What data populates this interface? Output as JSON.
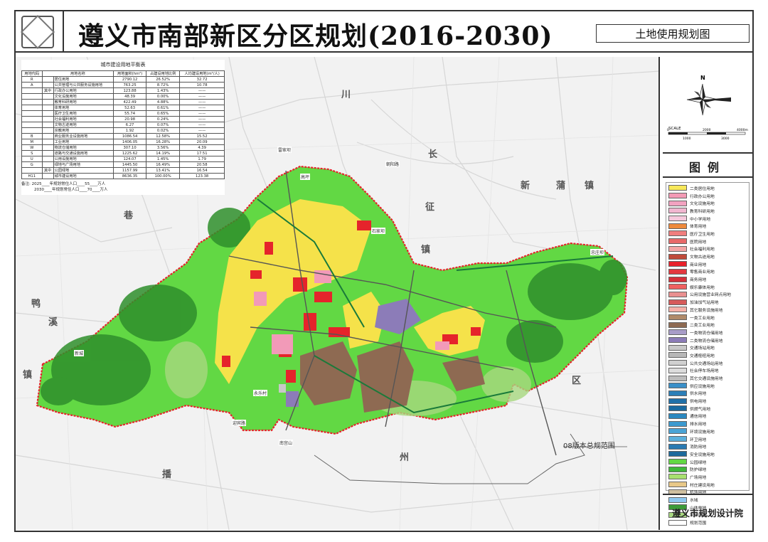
{
  "header": {
    "title": "遵义市南部新区分区规划(2016-2030)",
    "subtitle": "土地使用规划图"
  },
  "map": {
    "place_labels": [
      "川",
      "长",
      "征",
      "镇",
      "新",
      "蒲",
      "镇",
      "巷",
      "鸭",
      "溪",
      "镇",
      "区",
      "州",
      "播"
    ],
    "small_labels": [
      "雷家坝",
      "高坪",
      "石家坝",
      "忠庄坝",
      "新城",
      "永乐村",
      "迎宾路",
      "南宫山",
      "朝阳路"
    ],
    "scope_label": "08版本总规范围"
  },
  "table": {
    "title": "城市建设用地平衡表",
    "headers": [
      "用地代码",
      "用地名称",
      "用地面积(hm²)",
      "占建设用地比例",
      "人均建设用地(m²/人)"
    ],
    "rows": [
      [
        "R",
        "",
        "居住用地",
        "2790.12",
        "26.52%",
        "32.72"
      ],
      [
        "A",
        "",
        "公共管理与公共服务设施用地",
        "763.25",
        "8.72%",
        "10.78"
      ],
      [
        "",
        "其中",
        "行政办公用地",
        "123.88",
        "1.43%",
        "——"
      ],
      [
        "",
        "",
        "文化设施用地",
        "48.39",
        "0.00%",
        "——"
      ],
      [
        "",
        "",
        "教育科研用地",
        "422.49",
        "4.88%",
        "——"
      ],
      [
        "",
        "",
        "体育用地",
        "52.63",
        "0.61%",
        "——"
      ],
      [
        "",
        "",
        "医疗卫生用地",
        "55.74",
        "0.65%",
        "——"
      ],
      [
        "",
        "",
        "社会福利用地",
        "20.98",
        "0.24%",
        "——"
      ],
      [
        "",
        "",
        "文物古迹用地",
        "6.27",
        "0.07%",
        "——"
      ],
      [
        "",
        "",
        "宗教用地",
        "1.92",
        "0.02%",
        "——"
      ],
      [
        "B",
        "",
        "商业服务业设施用地",
        "1086.54",
        "12.58%",
        "15.52"
      ],
      [
        "M",
        "",
        "工业用地",
        "1406.05",
        "16.28%",
        "20.09"
      ],
      [
        "W",
        "",
        "物流仓储用地",
        "307.10",
        "3.56%",
        "4.39"
      ],
      [
        "S",
        "",
        "道路与交通设施用地",
        "1225.62",
        "14.19%",
        "17.51"
      ],
      [
        "U",
        "",
        "公用设施用地",
        "124.07",
        "1.45%",
        "1.79"
      ],
      [
        "G",
        "",
        "绿地与广场用地",
        "1445.50",
        "16.49%",
        "20.58"
      ],
      [
        "",
        "其中",
        "公园绿地",
        "1157.99",
        "13.41%",
        "16.54"
      ],
      [
        "H11",
        "",
        "城市建设用地",
        "8636.35",
        "100.00%",
        "123.38"
      ]
    ],
    "note_label": "备注:",
    "notes": [
      "2025____年规划常住人口____55____万人",
      "2030____年规划常住人口____70____万人"
    ]
  },
  "compass": {
    "north": "N",
    "scale_label": "SCALE",
    "scale_ticks": [
      "0",
      "1000",
      "2000",
      "3000",
      "4000m"
    ]
  },
  "legend": {
    "title": "图例",
    "items": [
      {
        "label": "二类居住用地",
        "color": "#f7e85a"
      },
      {
        "label": "行政办公用地",
        "color": "#f39ab5"
      },
      {
        "label": "文化设施用地",
        "color": "#f2a2c0"
      },
      {
        "label": "教育科研用地",
        "color": "#f1b6d0"
      },
      {
        "label": "中小学用地",
        "color": "#f5c8dc"
      },
      {
        "label": "体育用地",
        "color": "#ee8a3c"
      },
      {
        "label": "医疗卫生用地",
        "color": "#f07e7e"
      },
      {
        "label": "医院用地",
        "color": "#e86a6a"
      },
      {
        "label": "社会福利用地",
        "color": "#f4a6a6"
      },
      {
        "label": "文物古迹用地",
        "color": "#c04a3a"
      },
      {
        "label": "商业用地",
        "color": "#e8202a"
      },
      {
        "label": "零售商业用地",
        "color": "#e33840"
      },
      {
        "label": "商务用地",
        "color": "#d6303a"
      },
      {
        "label": "娱乐康体用地",
        "color": "#f06060"
      },
      {
        "label": "公用设施营业网点用地",
        "color": "#e99090"
      },
      {
        "label": "加油加气站用地",
        "color": "#d65a5a"
      },
      {
        "label": "其它服务设施用地",
        "color": "#f5b0a8"
      },
      {
        "label": "一类工业用地",
        "color": "#b08a6a"
      },
      {
        "label": "二类工业用地",
        "color": "#8e6a52"
      },
      {
        "label": "一类物流仓储用地",
        "color": "#a89cc8"
      },
      {
        "label": "二类物流仓储用地",
        "color": "#8c7cb8"
      },
      {
        "label": "交通场站用地",
        "color": "#c8c8c8"
      },
      {
        "label": "交通枢纽用地",
        "color": "#b8b8b8"
      },
      {
        "label": "公共交通场站用地",
        "color": "#d0d0d0"
      },
      {
        "label": "社会停车场用地",
        "color": "#dcdcdc"
      },
      {
        "label": "其它交通设施用地",
        "color": "#bcbcbc"
      },
      {
        "label": "供应设施用地",
        "color": "#3a8fc8"
      },
      {
        "label": "供水用地",
        "color": "#2c7fb8"
      },
      {
        "label": "供电用地",
        "color": "#2070a8"
      },
      {
        "label": "供燃气用地",
        "color": "#1a6aa0"
      },
      {
        "label": "通信用地",
        "color": "#2a88c0"
      },
      {
        "label": "排水用地",
        "color": "#3c9ad0"
      },
      {
        "label": "环境设施用地",
        "color": "#4aa4d6"
      },
      {
        "label": "环卫用地",
        "color": "#5cb0dc"
      },
      {
        "label": "消防用地",
        "color": "#2a7ab2"
      },
      {
        "label": "安全设施用地",
        "color": "#1e6a9c"
      },
      {
        "label": "公园绿地",
        "color": "#62d844"
      },
      {
        "label": "防护绿地",
        "color": "#3fb83a"
      },
      {
        "label": "广场用地",
        "color": "#a8e070"
      },
      {
        "label": "村庄建设用地",
        "color": "#e8c888"
      },
      {
        "label": "机场用地",
        "color": "#d0c0a0"
      },
      {
        "label": "水域",
        "color": "#8fc8f0"
      },
      {
        "label": "山体林地",
        "color": "#3c9a38"
      },
      {
        "label": "农林用地",
        "color": "#a8d880"
      },
      {
        "label": "规划范围",
        "color": "#ffffff"
      }
    ]
  },
  "footer": {
    "institute": "遵义市规划设计院"
  }
}
